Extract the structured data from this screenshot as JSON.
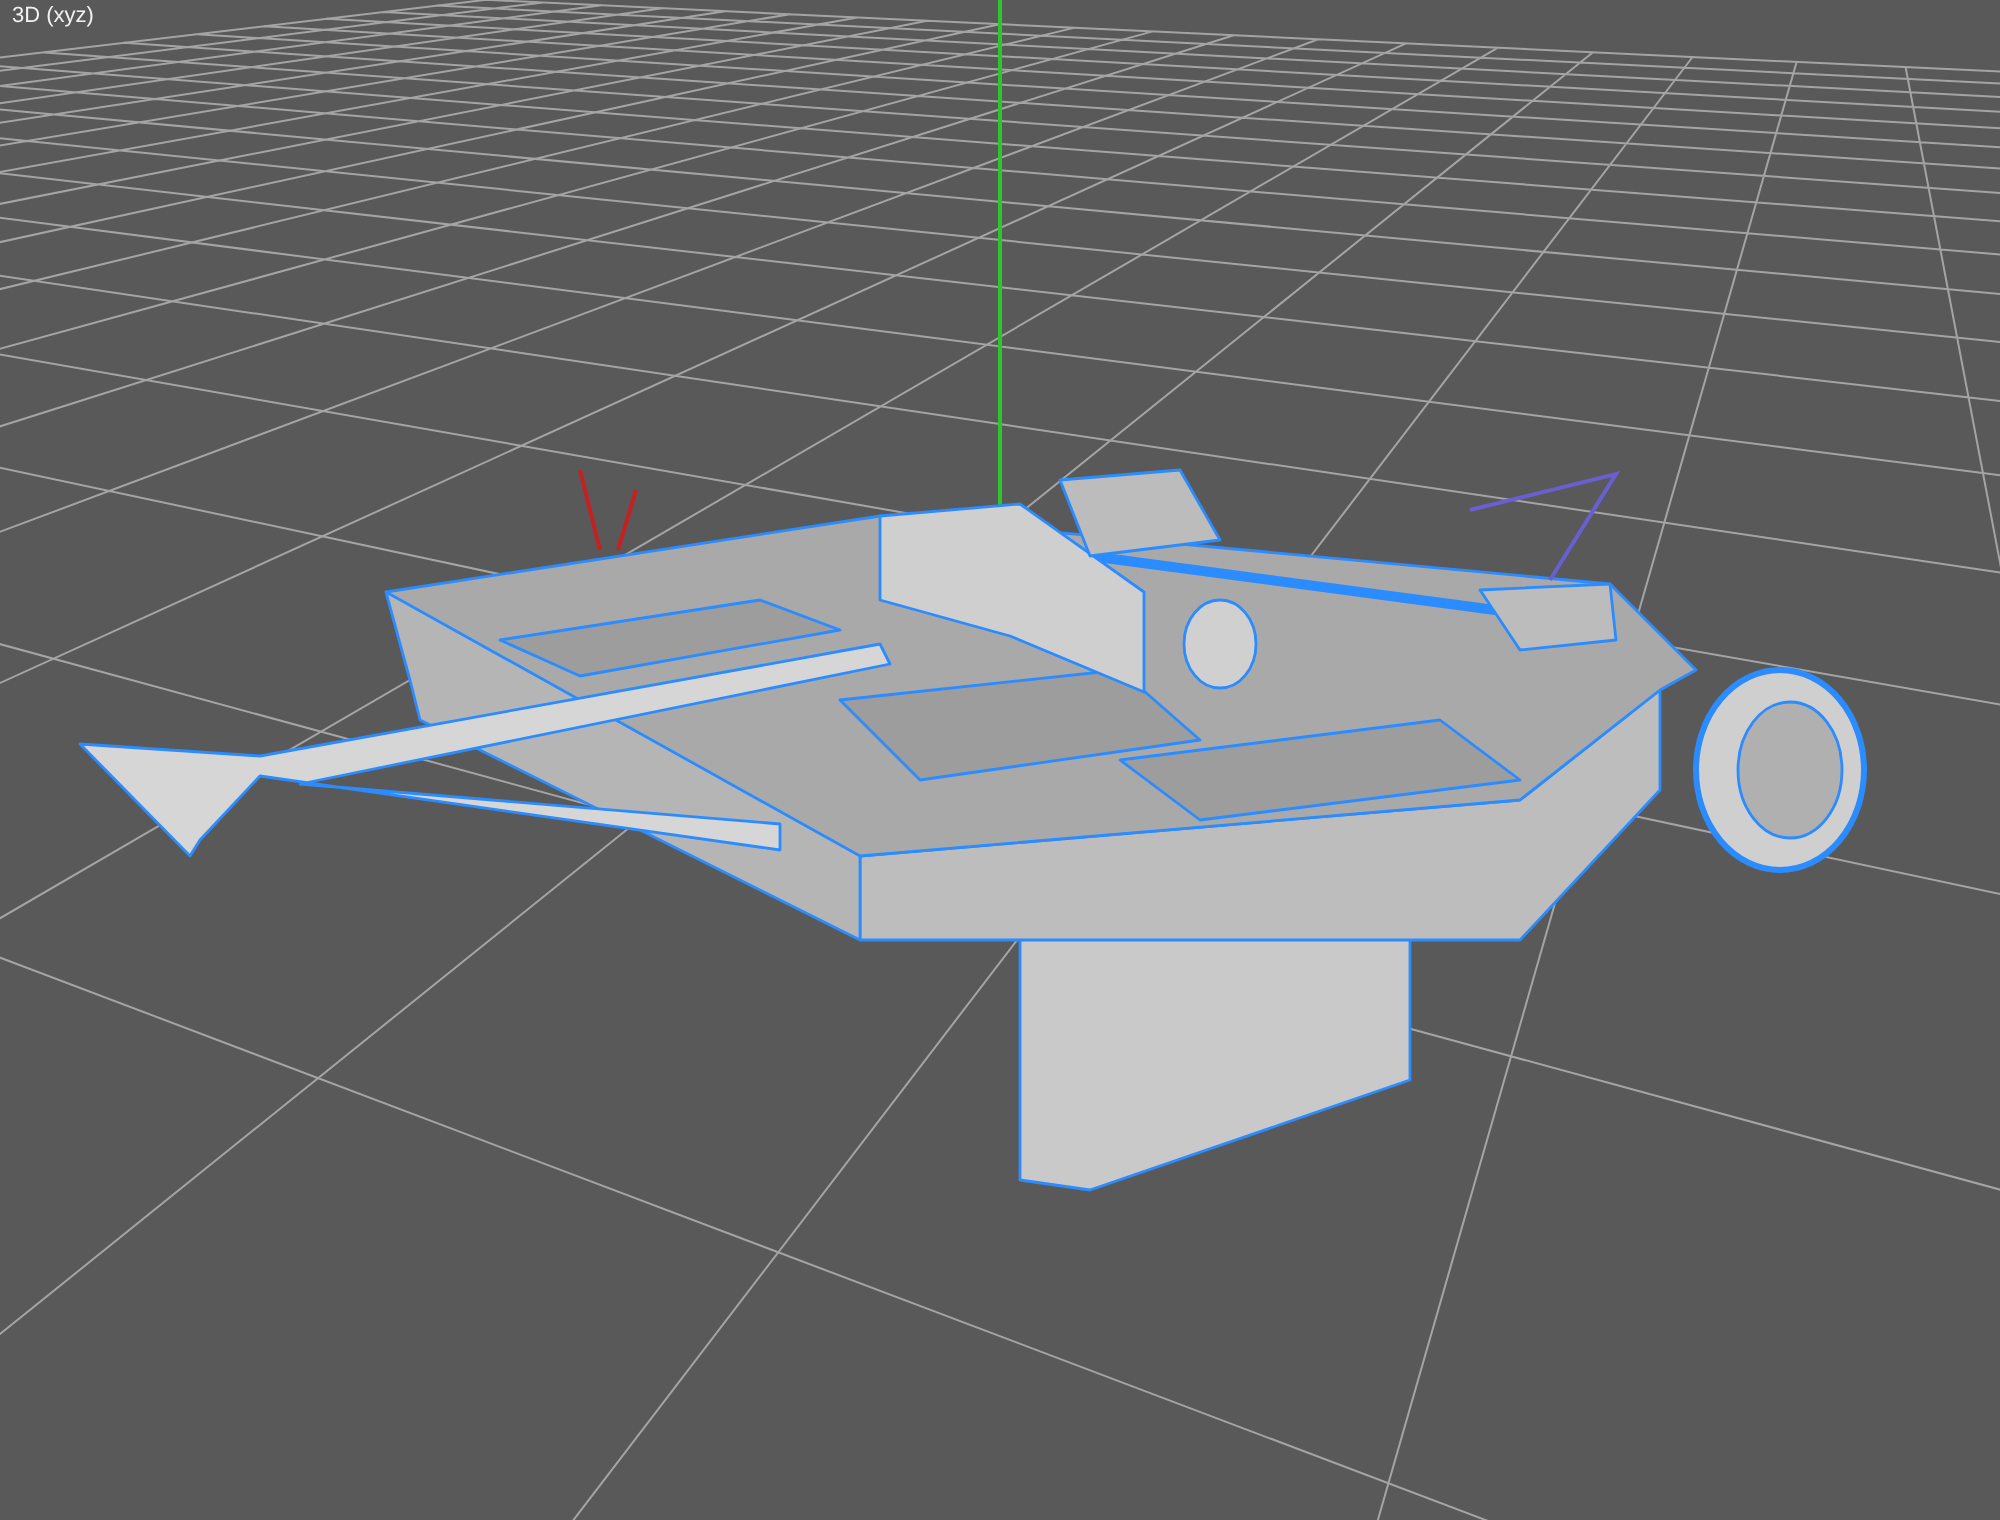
{
  "viewport": {
    "label": "3D (xyz)"
  }
}
